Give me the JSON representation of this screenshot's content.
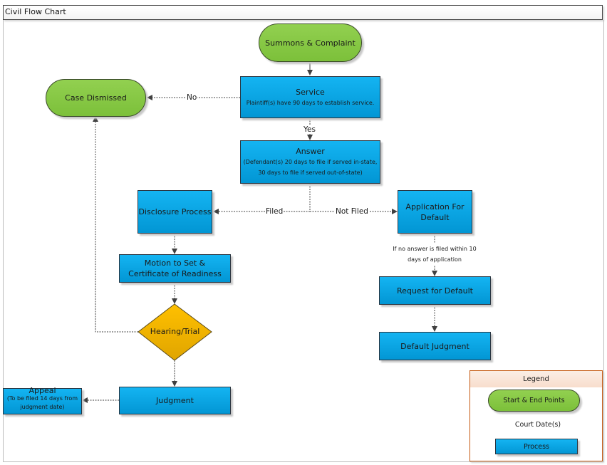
{
  "window": {
    "title": "Civil Flow Chart"
  },
  "nodes": {
    "summons": {
      "label": "Summons & Complaint",
      "shape": "terminator"
    },
    "service": {
      "label": "Service",
      "detail": "Plaintiff(s) have 90 days to establish service.",
      "shape": "process"
    },
    "case_dismissed": {
      "label": "Case Dismissed",
      "shape": "terminator"
    },
    "answer": {
      "label": "Answer",
      "detail_line1": "(Defendant(s) 20 days to file if served in-state,",
      "detail_line2": "30 days to file if served out-of-state)",
      "shape": "process"
    },
    "disclosure": {
      "label": "Disclosure Process",
      "shape": "process"
    },
    "application_default": {
      "label_line1": "Application For",
      "label_line2": "Default",
      "shape": "process"
    },
    "motion": {
      "label_line1": "Motion to Set &",
      "label_line2": "Certificate of Readiness",
      "shape": "process"
    },
    "request_default": {
      "label": "Request for Default",
      "shape": "process"
    },
    "hearing": {
      "label": "Hearing/Trial",
      "shape": "decision"
    },
    "default_judgment": {
      "label": "Default Judgment",
      "shape": "process"
    },
    "judgment": {
      "label": "Judgment",
      "shape": "process"
    },
    "appeal": {
      "label": "Appeal",
      "detail_line1": "(To be filed 14 days from",
      "detail_line2": "judgment date)",
      "shape": "process"
    }
  },
  "edges": {
    "no": "No",
    "yes": "Yes",
    "filed": "Filed",
    "not_filed": "Not Filed",
    "default_note_line1": "If no answer is filed within 10",
    "default_note_line2": "days of application"
  },
  "legend": {
    "title": "Legend",
    "items": [
      {
        "label": "Start & End Points",
        "shape": "terminator"
      },
      {
        "label": "Court Date(s)",
        "shape": "decision"
      },
      {
        "label": "Process",
        "shape": "process"
      }
    ]
  },
  "colors": {
    "process": "#00b0f0",
    "terminator": "#92d050",
    "decision": "#ffc000",
    "legend_border": "#c55a11",
    "connector": "#404040"
  }
}
